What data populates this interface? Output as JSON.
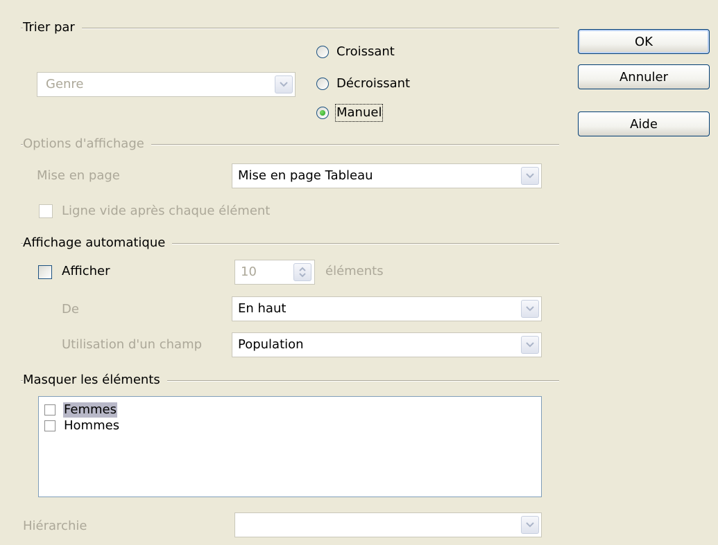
{
  "sort": {
    "title": "Trier par",
    "field": "Genre",
    "ascending": "Croissant",
    "descending": "Décroissant",
    "manual": "Manuel",
    "selected": "manual"
  },
  "display": {
    "title": "Options d'affichage",
    "layout_label": "Mise en page",
    "layout_value": "Mise en page Tableau",
    "empty_line_label": "Ligne vide après chaque élément"
  },
  "auto_show": {
    "title": "Affichage automatique",
    "show_label": "Afficher",
    "count": "10",
    "items_label": "éléments",
    "from_label": "De",
    "from_value": "En haut",
    "field_label": "Utilisation d'un champ",
    "field_value": "Population"
  },
  "hide_items": {
    "title": "Masquer les éléments",
    "items": [
      {
        "label": "Femmes",
        "checked": false,
        "selected": true
      },
      {
        "label": "Hommes",
        "checked": false,
        "selected": false
      }
    ]
  },
  "hierarchy": {
    "label": "Hiérarchie",
    "value": ""
  },
  "buttons": {
    "ok": "OK",
    "cancel": "Annuler",
    "help": "Aide"
  },
  "icons": {
    "dropdown": "chevron-down-icon",
    "spin": "spin-updown-icon"
  }
}
